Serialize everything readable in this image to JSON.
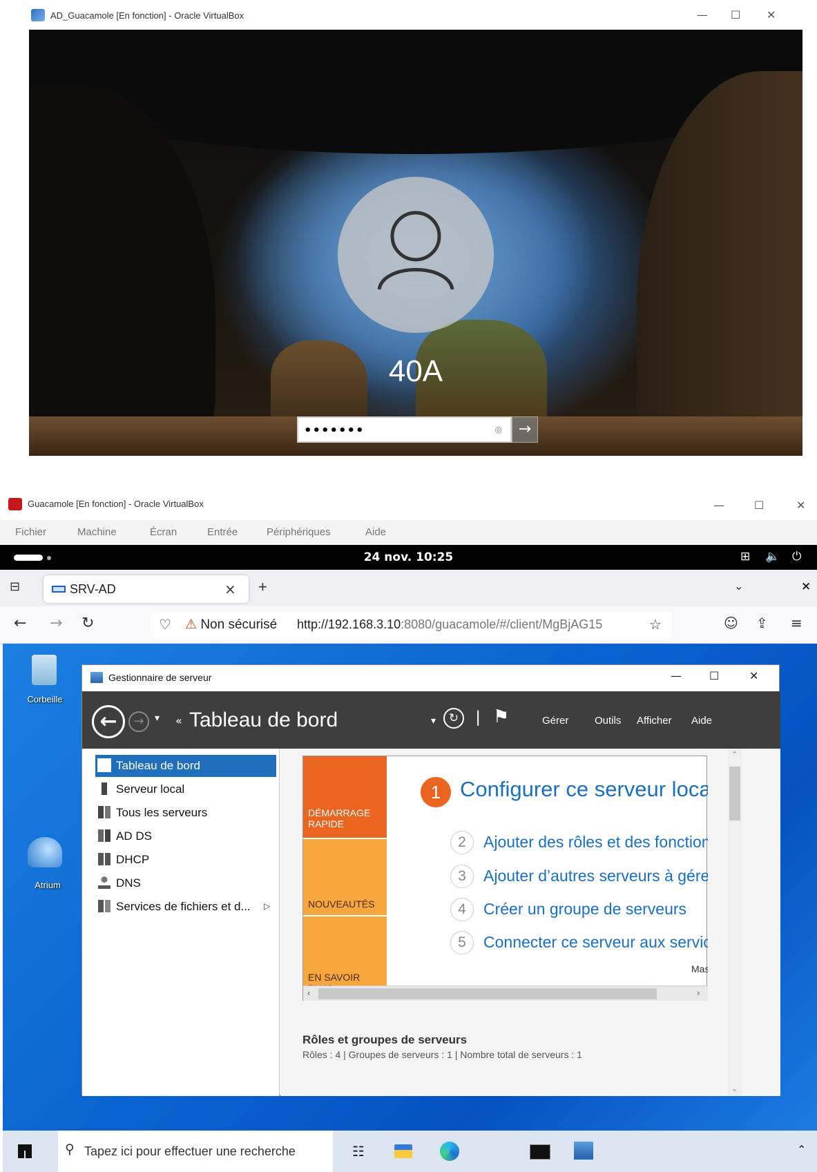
{
  "vm_top": {
    "window_title": "AD_Guacamole [En fonction] - Oracle VirtualBox",
    "lock_screen": {
      "username": "40A",
      "password_mask": "•••••••",
      "avatar_icon": "user-icon",
      "reveal_icon": "eye-icon",
      "submit_icon": "arrow-right-icon"
    }
  },
  "vm_bottom": {
    "window_title": "Guacamole [En fonction] - Oracle VirtualBox",
    "menu": [
      "Fichier",
      "Machine",
      "Écran",
      "Entrée",
      "Périphériques",
      "Aide"
    ],
    "gnome": {
      "clock": "24 nov.  10:25"
    },
    "browser": {
      "tab_title": "SRV-AD",
      "url_security": "Non sécurisé",
      "url_host": "http://192.168.3.10",
      "url_rest": ":8080/guacamole/#/client/MgBjAG15",
      "new_tab": "+"
    },
    "desktop": {
      "icons": [
        "Corbeille",
        "Atrium"
      ]
    },
    "server_manager": {
      "window_title": "Gestionnaire de serveur",
      "header_title": "Tableau de bord",
      "header_menu": [
        "Gérer",
        "Outils",
        "Afficher",
        "Aide"
      ],
      "nav": [
        {
          "label": "Tableau de bord",
          "icon": "dashboard-icon",
          "active": true
        },
        {
          "label": "Serveur local",
          "icon": "server-icon"
        },
        {
          "label": "Tous les serveurs",
          "icon": "servers-icon"
        },
        {
          "label": "AD DS",
          "icon": "adds-icon"
        },
        {
          "label": "DHCP",
          "icon": "dhcp-icon"
        },
        {
          "label": "DNS",
          "icon": "dns-icon"
        },
        {
          "label": "Services de fichiers et d...",
          "icon": "file-services-icon"
        }
      ],
      "quick_start": {
        "tiles": [
          "DÉMARRAGE RAPIDE",
          "NOUVEAUTÉS",
          "EN SAVOIR PLUS"
        ],
        "step1": {
          "num": "1",
          "label": "Configurer ce serveur local"
        },
        "steps": [
          {
            "num": "2",
            "label": "Ajouter des rôles et des fonctionnalités"
          },
          {
            "num": "3",
            "label": "Ajouter d’autres serveurs à gérer"
          },
          {
            "num": "4",
            "label": "Créer un groupe de serveurs"
          },
          {
            "num": "5",
            "label": "Connecter ce serveur aux services cloud"
          }
        ],
        "hide_link": "Masquer"
      },
      "roles": {
        "title": "Rôles et groupes de serveurs",
        "summary": "Rôles : 4   |   Groupes de serveurs : 1   |   Nombre total de serveurs : 1"
      }
    },
    "taskbar": {
      "search_placeholder": "Tapez ici pour effectuer une recherche"
    }
  }
}
